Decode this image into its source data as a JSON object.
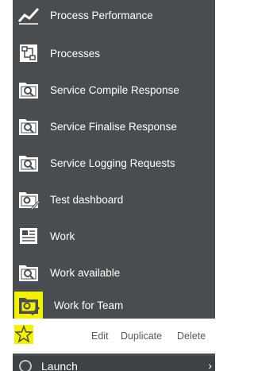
{
  "menu": {
    "items": [
      {
        "label": "Process Performance",
        "icon": "chart-line-icon"
      },
      {
        "label": "Processes",
        "icon": "process-diagram-icon"
      },
      {
        "label": "Service Compile Response",
        "icon": "dashboard-search-icon"
      },
      {
        "label": "Service Finalise Response",
        "icon": "dashboard-search-icon"
      },
      {
        "label": "Service Logging Requests",
        "icon": "dashboard-search-icon"
      },
      {
        "label": "Test dashboard",
        "icon": "dashboard-edit-icon"
      },
      {
        "label": "Work",
        "icon": "work-list-icon"
      },
      {
        "label": "Work available",
        "icon": "dashboard-search-icon"
      },
      {
        "label": "Work for Team",
        "icon": "dashboard-edit-icon"
      }
    ]
  },
  "actions": {
    "edit": "Edit",
    "duplicate": "Duplicate",
    "delete": "Delete"
  },
  "bottom": {
    "label": "Launch"
  },
  "colors": {
    "panel": "#4a4d4f",
    "highlight": "#f2f200",
    "text": "#ffffff"
  }
}
